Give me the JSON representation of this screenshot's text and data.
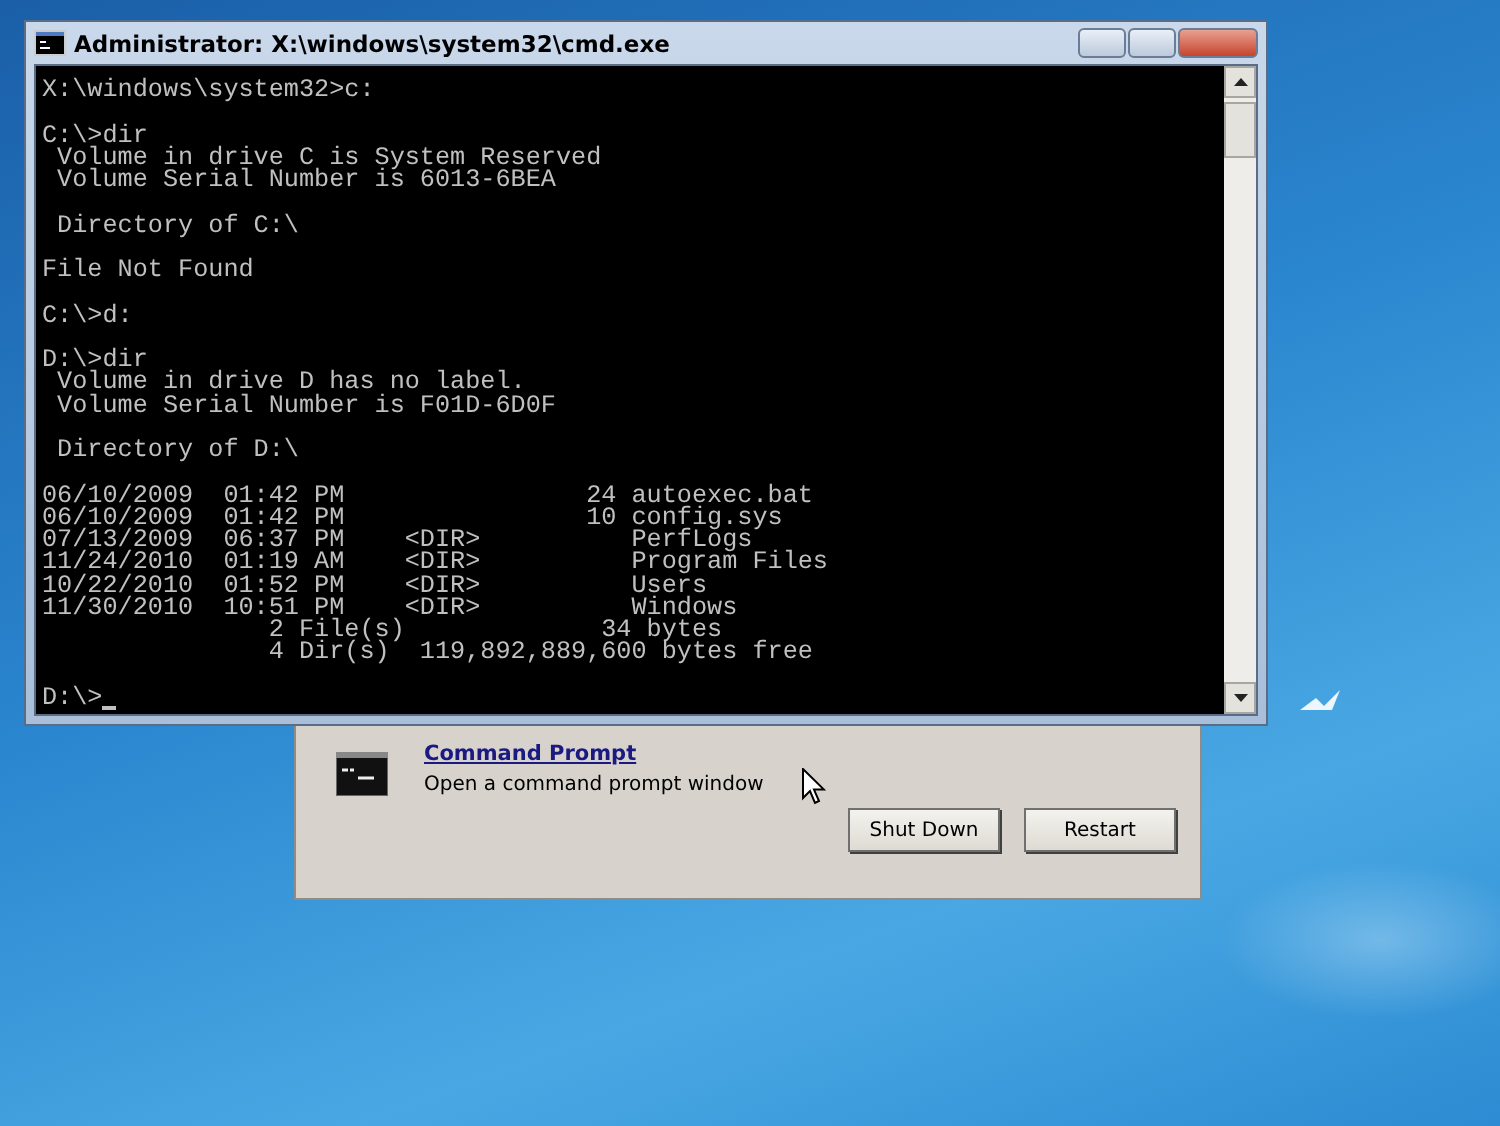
{
  "window": {
    "title": "Administrator: X:\\windows\\system32\\cmd.exe"
  },
  "console": {
    "blocks": [
      [
        "X:\\windows\\system32>c:"
      ],
      [
        "C:\\>dir",
        " Volume in drive C is System Reserved",
        " Volume Serial Number is 6013-6BEA"
      ],
      [
        " Directory of C:\\"
      ],
      [
        "File Not Found"
      ],
      [
        "C:\\>d:"
      ],
      [
        "D:\\>dir",
        " Volume in drive D has no label.",
        " Volume Serial Number is F01D-6D0F"
      ],
      [
        " Directory of D:\\"
      ],
      [
        "06/10/2009  01:42 PM                24 autoexec.bat",
        "06/10/2009  01:42 PM                10 config.sys",
        "07/13/2009  06:37 PM    <DIR>          PerfLogs",
        "11/24/2010  01:19 AM    <DIR>          Program Files",
        "10/22/2010  01:52 PM    <DIR>          Users",
        "11/30/2010  10:51 PM    <DIR>          Windows",
        "               2 File(s)             34 bytes",
        "               4 Dir(s)  119,892,889,600 bytes free"
      ],
      [
        "D:\\>"
      ]
    ]
  },
  "recovery_panel": {
    "tool": {
      "title": "Command Prompt",
      "description": "Open a command prompt window"
    },
    "buttons": [
      "Shut Down",
      "Restart"
    ]
  }
}
